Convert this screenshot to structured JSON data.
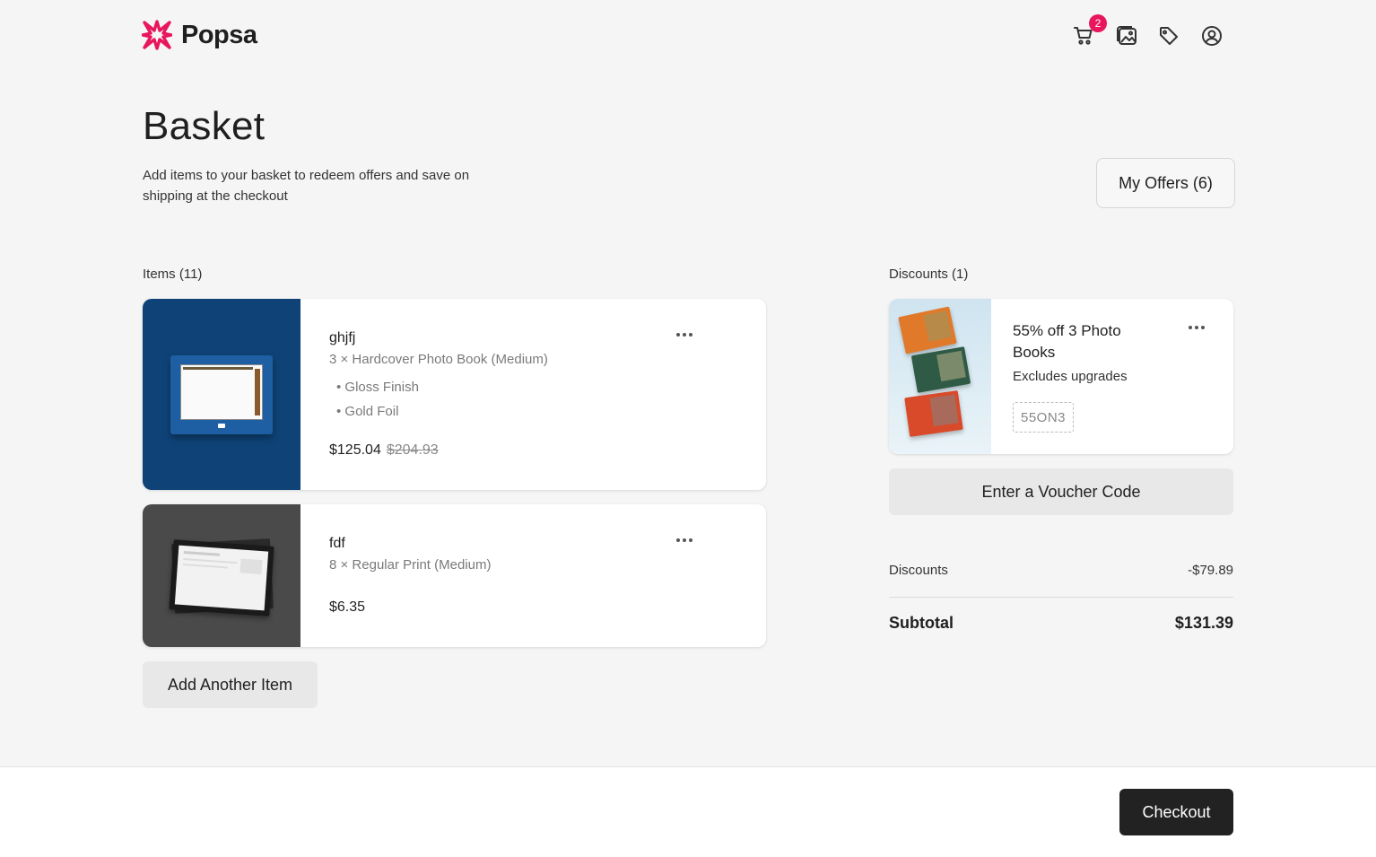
{
  "brand": {
    "name": "Popsa",
    "accent": "#e8175d"
  },
  "nav": {
    "cart_count": "2",
    "icons": [
      "cart-icon",
      "photos-icon",
      "tag-icon",
      "account-icon"
    ]
  },
  "page": {
    "title": "Basket",
    "subtitle": "Add items to your basket to redeem offers and save on shipping at the checkout",
    "offers_button": "My Offers (6)"
  },
  "items_section": {
    "label": "Items (11)",
    "items": [
      {
        "name": "ghjfj",
        "description": "3 × Hardcover Photo Book (Medium)",
        "options": [
          "• Gloss Finish",
          "• Gold Foil"
        ],
        "price": "$125.04",
        "old_price": "$204.93"
      },
      {
        "name": "fdf",
        "description": "8 × Regular Print (Medium)",
        "price": "$6.35"
      }
    ],
    "add_button": "Add Another Item"
  },
  "discounts_section": {
    "label": "Discounts (1)",
    "discount": {
      "title": "55% off 3 Photo Books",
      "note": "Excludes upgrades",
      "code": "55ON3"
    },
    "voucher_button": "Enter a Voucher Code"
  },
  "summary": {
    "discounts_label": "Discounts",
    "discounts_value": "-$79.89",
    "subtotal_label": "Subtotal",
    "subtotal_value": "$131.39"
  },
  "footer": {
    "checkout_button": "Checkout"
  }
}
